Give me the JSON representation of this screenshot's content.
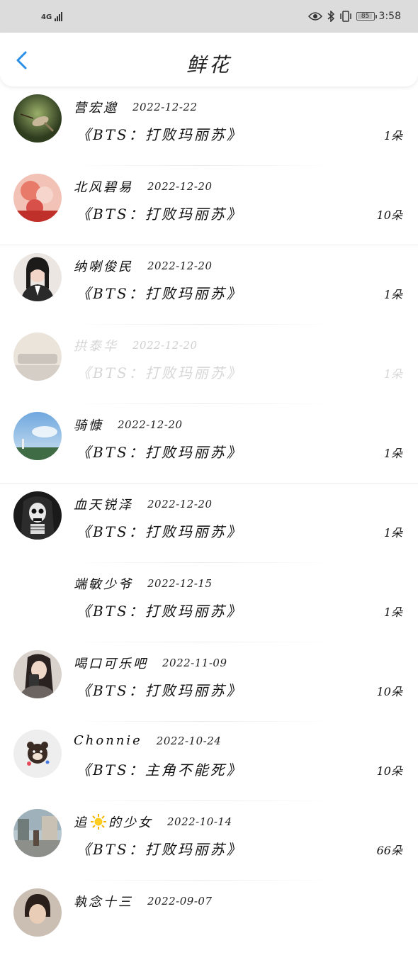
{
  "statusbar": {
    "network": "4G",
    "battery": "85",
    "time": "3:58"
  },
  "header": {
    "title": "鲜花",
    "back_icon": "chevron-left-icon"
  },
  "items": [
    {
      "name": "营宏邈",
      "date": "2022-12-22",
      "book": "《BTS：打败玛丽苏》",
      "count": "1朵",
      "avatar": "hummingbird"
    },
    {
      "name": "北风碧易",
      "date": "2022-12-20",
      "book": "《BTS：打败玛丽苏》",
      "count": "10朵",
      "avatar": "pink-flowers"
    },
    {
      "name": "纳喇俊民",
      "date": "2022-12-20",
      "book": "《BTS：打败玛丽苏》",
      "count": "1朵",
      "avatar": "girl-portrait"
    },
    {
      "name": "拱泰华",
      "date": "2022-12-20",
      "book": "《BTS：打败玛丽苏》",
      "count": "1朵",
      "avatar": "boat"
    },
    {
      "name": "骑慷",
      "date": "2022-12-20",
      "book": "《BTS：打败玛丽苏》",
      "count": "1朵",
      "avatar": "sky-landscape"
    },
    {
      "name": "血天锐泽",
      "date": "2022-12-20",
      "book": "《BTS：打败玛丽苏》",
      "count": "1朵",
      "avatar": "skeleton"
    },
    {
      "name": "端敏少爷",
      "date": "2022-12-15",
      "book": "《BTS：打败玛丽苏》",
      "count": "1朵",
      "avatar": "none"
    },
    {
      "name": "喝口可乐吧",
      "date": "2022-11-09",
      "book": "《BTS：打败玛丽苏》",
      "count": "10朵",
      "avatar": "selfie-girl"
    },
    {
      "name": "Chonnie",
      "date": "2022-10-24",
      "book": "《BTS：主角不能死》",
      "count": "10朵",
      "avatar": "cartoon-bear"
    },
    {
      "name_parts": [
        "追",
        "的少女"
      ],
      "date": "2022-10-14",
      "book": "《BTS：打败玛丽苏》",
      "count": "66朵",
      "avatar": "street-photo"
    },
    {
      "name": "執念十三",
      "date": "2022-09-07",
      "book": "",
      "count": "",
      "avatar": "man-portrait"
    }
  ]
}
